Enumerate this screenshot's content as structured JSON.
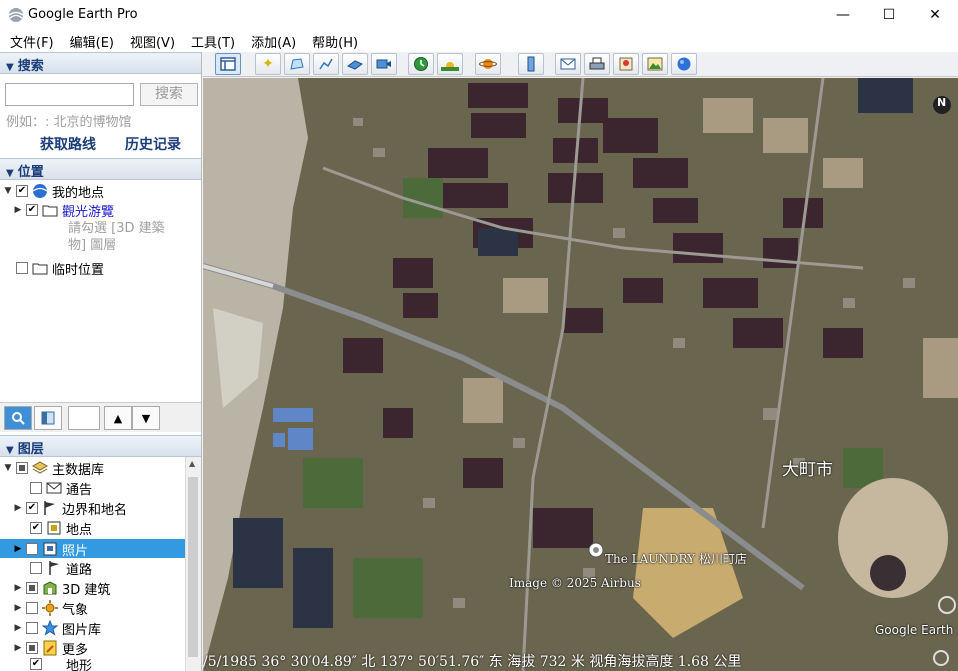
{
  "window": {
    "title": "Google Earth Pro",
    "minimize": "—",
    "maximize": "☐",
    "close": "✕"
  },
  "menu": [
    "文件(F)",
    "编辑(E)",
    "视图(V)",
    "工具(T)",
    "添加(A)",
    "帮助(H)"
  ],
  "search": {
    "header": "搜索",
    "input_value": "",
    "button": "搜索",
    "hint": "例如：: 北京的博物馆",
    "get_route": "获取路线",
    "history": "历史记录"
  },
  "places": {
    "header": "位置",
    "my_places": "我的地点",
    "tour": "觀光游覽",
    "tour_hint_1": "請勾選 [3D 建築",
    "tour_hint_2": "物] 圖層",
    "temp_places": "临时位置"
  },
  "layers": {
    "header": "图层",
    "items": [
      "主数据库",
      "通告",
      "边界和地名",
      "地点",
      "照片",
      "道路",
      "3D 建筑",
      "气象",
      "图片库",
      "更多",
      "地形"
    ]
  },
  "map": {
    "place_label": "大町市",
    "poi_label": "The LAUNDRY 松川町店",
    "credit": "Image © 2025 Airbus",
    "logo": "Google Earth",
    "compass": "N",
    "status": "/5/1985 36° 30′04.89″ 北 137° 50′51.76″ 东 海拔  732 米   视角海拔高度  1.68 公里"
  },
  "colors": {
    "header_text": "#1b3d7a",
    "selection": "#3399e0",
    "link": "#1b3d7a"
  }
}
